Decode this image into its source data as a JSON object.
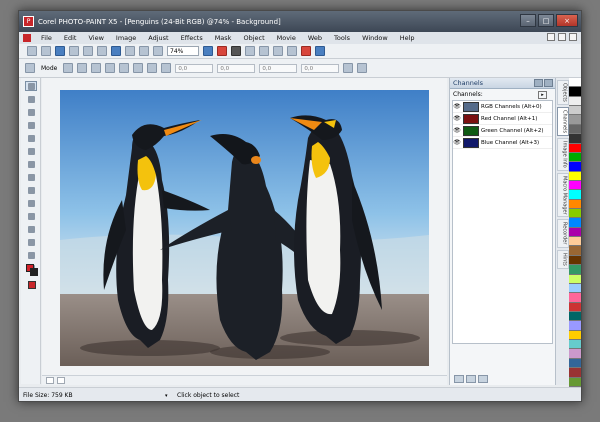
{
  "window": {
    "title": "Corel PHOTO-PAINT X5 - [Penguins (24-Bit RGB) @74% - Background]",
    "app_icon_letter": "P",
    "controls": [
      "–",
      "□",
      "×"
    ]
  },
  "menu": {
    "items": [
      "File",
      "Edit",
      "View",
      "Image",
      "Adjust",
      "Effects",
      "Mask",
      "Object",
      "Movie",
      "Web",
      "Tools",
      "Window",
      "Help"
    ]
  },
  "toolbar": {
    "zoom_value": "74%",
    "mode_label": "Mode",
    "field_placeholder": "0,0"
  },
  "channels_panel": {
    "title": "Channels",
    "subtitle": "Channels:",
    "channels": [
      {
        "name": "RGB Channels (Alt+0)",
        "thumb_color": "#556b8a"
      },
      {
        "name": "Red Channel (Alt+1)",
        "thumb_color": "#7a1010"
      },
      {
        "name": "Green Channel (Alt+2)",
        "thumb_color": "#0f5a14"
      },
      {
        "name": "Blue Channel (Alt+3)",
        "thumb_color": "#10186a"
      }
    ]
  },
  "docker_tabs": [
    "Objects",
    "Channels",
    "Image Info",
    "Macro Manager",
    "Recorder",
    "Hints"
  ],
  "status": {
    "file_size": "File Size: 759 KB",
    "hint": "Click object to select"
  },
  "colors": {
    "accent_red": "#c8262a",
    "panel_title": "#1f3d66"
  },
  "palette": [
    "#ffffff",
    "#000000",
    "#eeeeee",
    "#cccccc",
    "#999999",
    "#666666",
    "#333333",
    "#ff0000",
    "#00aa00",
    "#0000ff",
    "#ffff00",
    "#ff00ff",
    "#00ffff",
    "#ff8800",
    "#88cc00",
    "#0088ff",
    "#aa00aa",
    "#ffcc99",
    "#996633",
    "#663300",
    "#339966",
    "#ccff66",
    "#99ccff",
    "#ff6699",
    "#cc3333",
    "#006666",
    "#9999ff",
    "#ffcc00",
    "#66cccc",
    "#cc99cc",
    "#336699",
    "#993333",
    "#669933"
  ]
}
